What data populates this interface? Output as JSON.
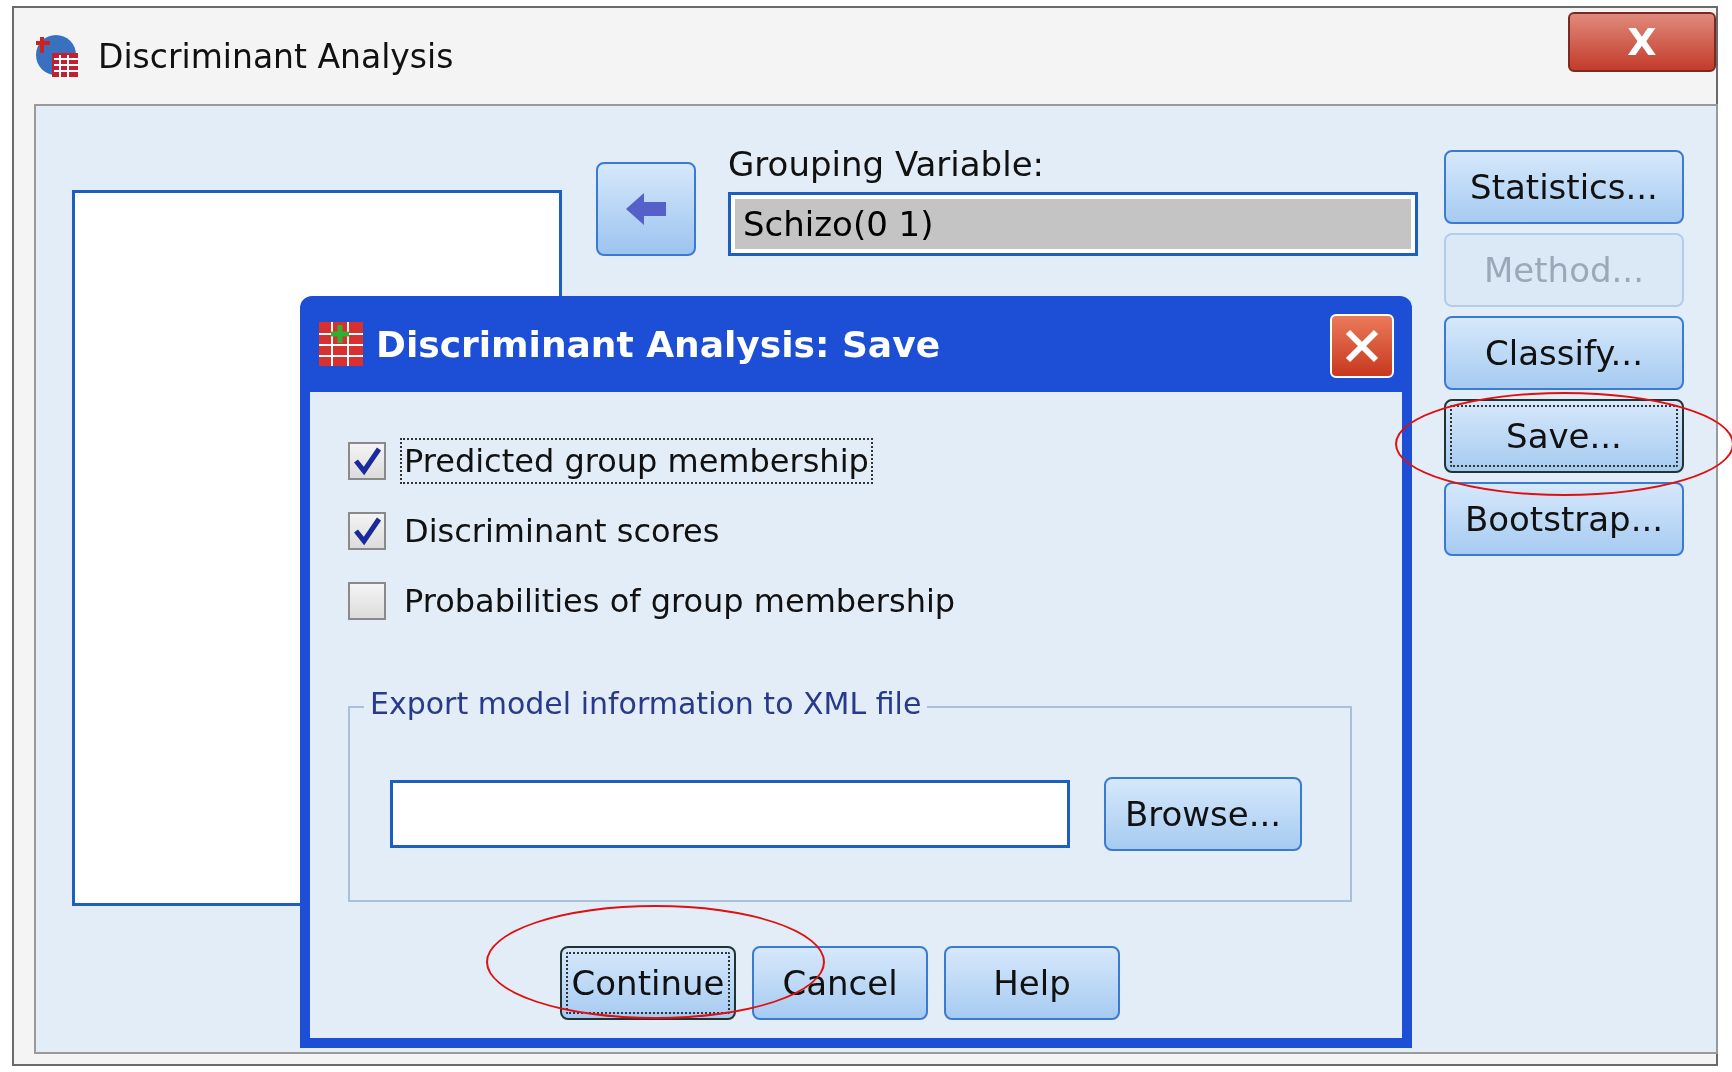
{
  "window": {
    "title": "Discriminant Analysis",
    "close_label": "X"
  },
  "grouping": {
    "label": "Grouping Variable:",
    "value": "Schizo(0 1)"
  },
  "side_buttons": [
    {
      "label": "Statistics...",
      "disabled": false,
      "focused": false,
      "circled": false
    },
    {
      "label": "Method...",
      "disabled": true,
      "focused": false,
      "circled": false
    },
    {
      "label": "Classify...",
      "disabled": false,
      "focused": false,
      "circled": false
    },
    {
      "label": "Save...",
      "disabled": false,
      "focused": true,
      "circled": true
    },
    {
      "label": "Bootstrap...",
      "disabled": false,
      "focused": false,
      "circled": false
    }
  ],
  "dialog": {
    "title": "Discriminant Analysis: Save",
    "options": [
      {
        "label": "Predicted group membership",
        "checked": true,
        "focused": true
      },
      {
        "label": "Discriminant scores",
        "checked": true,
        "focused": false
      },
      {
        "label": "Probabilities of group membership",
        "checked": false,
        "focused": false
      }
    ],
    "export": {
      "legend": "Export model information to XML file",
      "browse": "Browse..."
    },
    "buttons": [
      {
        "label": "Continue",
        "focused": true,
        "circled": true
      },
      {
        "label": "Cancel",
        "focused": false,
        "circled": false
      },
      {
        "label": "Help",
        "focused": false,
        "circled": false
      }
    ]
  }
}
